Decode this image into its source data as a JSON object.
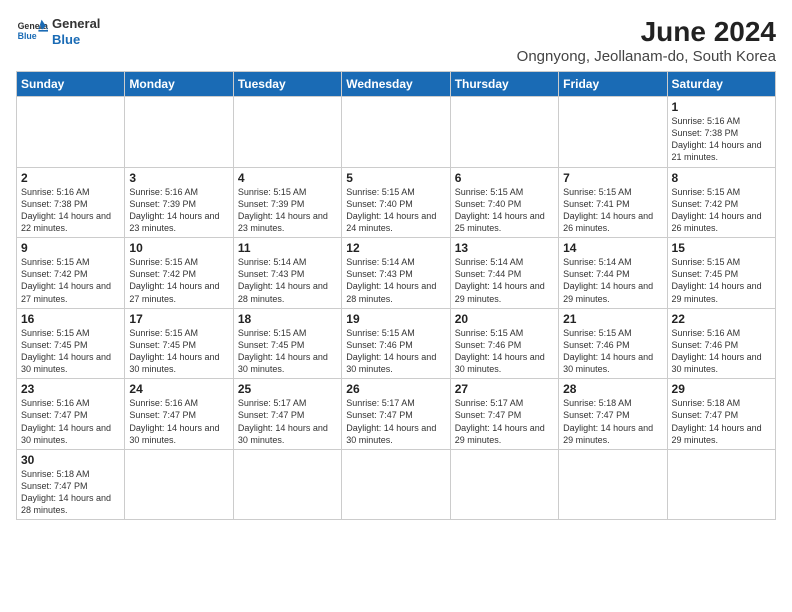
{
  "logo": {
    "line1": "General",
    "line2": "Blue"
  },
  "title": "June 2024",
  "subtitle": "Ongnyong, Jeollanam-do, South Korea",
  "weekdays": [
    "Sunday",
    "Monday",
    "Tuesday",
    "Wednesday",
    "Thursday",
    "Friday",
    "Saturday"
  ],
  "weeks": [
    [
      null,
      null,
      null,
      null,
      null,
      null,
      {
        "day": "1",
        "sunrise": "Sunrise: 5:16 AM",
        "sunset": "Sunset: 7:38 PM",
        "daylight": "Daylight: 14 hours and 21 minutes."
      }
    ],
    [
      {
        "day": "2",
        "sunrise": "Sunrise: 5:16 AM",
        "sunset": "Sunset: 7:38 PM",
        "daylight": "Daylight: 14 hours and 22 minutes."
      },
      {
        "day": "3",
        "sunrise": "Sunrise: 5:16 AM",
        "sunset": "Sunset: 7:39 PM",
        "daylight": "Daylight: 14 hours and 23 minutes."
      },
      {
        "day": "4",
        "sunrise": "Sunrise: 5:15 AM",
        "sunset": "Sunset: 7:39 PM",
        "daylight": "Daylight: 14 hours and 23 minutes."
      },
      {
        "day": "5",
        "sunrise": "Sunrise: 5:15 AM",
        "sunset": "Sunset: 7:40 PM",
        "daylight": "Daylight: 14 hours and 24 minutes."
      },
      {
        "day": "6",
        "sunrise": "Sunrise: 5:15 AM",
        "sunset": "Sunset: 7:40 PM",
        "daylight": "Daylight: 14 hours and 25 minutes."
      },
      {
        "day": "7",
        "sunrise": "Sunrise: 5:15 AM",
        "sunset": "Sunset: 7:41 PM",
        "daylight": "Daylight: 14 hours and 26 minutes."
      },
      {
        "day": "8",
        "sunrise": "Sunrise: 5:15 AM",
        "sunset": "Sunset: 7:42 PM",
        "daylight": "Daylight: 14 hours and 26 minutes."
      }
    ],
    [
      {
        "day": "9",
        "sunrise": "Sunrise: 5:15 AM",
        "sunset": "Sunset: 7:42 PM",
        "daylight": "Daylight: 14 hours and 27 minutes."
      },
      {
        "day": "10",
        "sunrise": "Sunrise: 5:15 AM",
        "sunset": "Sunset: 7:42 PM",
        "daylight": "Daylight: 14 hours and 27 minutes."
      },
      {
        "day": "11",
        "sunrise": "Sunrise: 5:14 AM",
        "sunset": "Sunset: 7:43 PM",
        "daylight": "Daylight: 14 hours and 28 minutes."
      },
      {
        "day": "12",
        "sunrise": "Sunrise: 5:14 AM",
        "sunset": "Sunset: 7:43 PM",
        "daylight": "Daylight: 14 hours and 28 minutes."
      },
      {
        "day": "13",
        "sunrise": "Sunrise: 5:14 AM",
        "sunset": "Sunset: 7:44 PM",
        "daylight": "Daylight: 14 hours and 29 minutes."
      },
      {
        "day": "14",
        "sunrise": "Sunrise: 5:14 AM",
        "sunset": "Sunset: 7:44 PM",
        "daylight": "Daylight: 14 hours and 29 minutes."
      },
      {
        "day": "15",
        "sunrise": "Sunrise: 5:15 AM",
        "sunset": "Sunset: 7:45 PM",
        "daylight": "Daylight: 14 hours and 29 minutes."
      }
    ],
    [
      {
        "day": "16",
        "sunrise": "Sunrise: 5:15 AM",
        "sunset": "Sunset: 7:45 PM",
        "daylight": "Daylight: 14 hours and 30 minutes."
      },
      {
        "day": "17",
        "sunrise": "Sunrise: 5:15 AM",
        "sunset": "Sunset: 7:45 PM",
        "daylight": "Daylight: 14 hours and 30 minutes."
      },
      {
        "day": "18",
        "sunrise": "Sunrise: 5:15 AM",
        "sunset": "Sunset: 7:45 PM",
        "daylight": "Daylight: 14 hours and 30 minutes."
      },
      {
        "day": "19",
        "sunrise": "Sunrise: 5:15 AM",
        "sunset": "Sunset: 7:46 PM",
        "daylight": "Daylight: 14 hours and 30 minutes."
      },
      {
        "day": "20",
        "sunrise": "Sunrise: 5:15 AM",
        "sunset": "Sunset: 7:46 PM",
        "daylight": "Daylight: 14 hours and 30 minutes."
      },
      {
        "day": "21",
        "sunrise": "Sunrise: 5:15 AM",
        "sunset": "Sunset: 7:46 PM",
        "daylight": "Daylight: 14 hours and 30 minutes."
      },
      {
        "day": "22",
        "sunrise": "Sunrise: 5:16 AM",
        "sunset": "Sunset: 7:46 PM",
        "daylight": "Daylight: 14 hours and 30 minutes."
      }
    ],
    [
      {
        "day": "23",
        "sunrise": "Sunrise: 5:16 AM",
        "sunset": "Sunset: 7:47 PM",
        "daylight": "Daylight: 14 hours and 30 minutes."
      },
      {
        "day": "24",
        "sunrise": "Sunrise: 5:16 AM",
        "sunset": "Sunset: 7:47 PM",
        "daylight": "Daylight: 14 hours and 30 minutes."
      },
      {
        "day": "25",
        "sunrise": "Sunrise: 5:17 AM",
        "sunset": "Sunset: 7:47 PM",
        "daylight": "Daylight: 14 hours and 30 minutes."
      },
      {
        "day": "26",
        "sunrise": "Sunrise: 5:17 AM",
        "sunset": "Sunset: 7:47 PM",
        "daylight": "Daylight: 14 hours and 30 minutes."
      },
      {
        "day": "27",
        "sunrise": "Sunrise: 5:17 AM",
        "sunset": "Sunset: 7:47 PM",
        "daylight": "Daylight: 14 hours and 29 minutes."
      },
      {
        "day": "28",
        "sunrise": "Sunrise: 5:18 AM",
        "sunset": "Sunset: 7:47 PM",
        "daylight": "Daylight: 14 hours and 29 minutes."
      },
      {
        "day": "29",
        "sunrise": "Sunrise: 5:18 AM",
        "sunset": "Sunset: 7:47 PM",
        "daylight": "Daylight: 14 hours and 29 minutes."
      }
    ],
    [
      {
        "day": "30",
        "sunrise": "Sunrise: 5:18 AM",
        "sunset": "Sunset: 7:47 PM",
        "daylight": "Daylight: 14 hours and 28 minutes."
      },
      null,
      null,
      null,
      null,
      null,
      null
    ]
  ]
}
